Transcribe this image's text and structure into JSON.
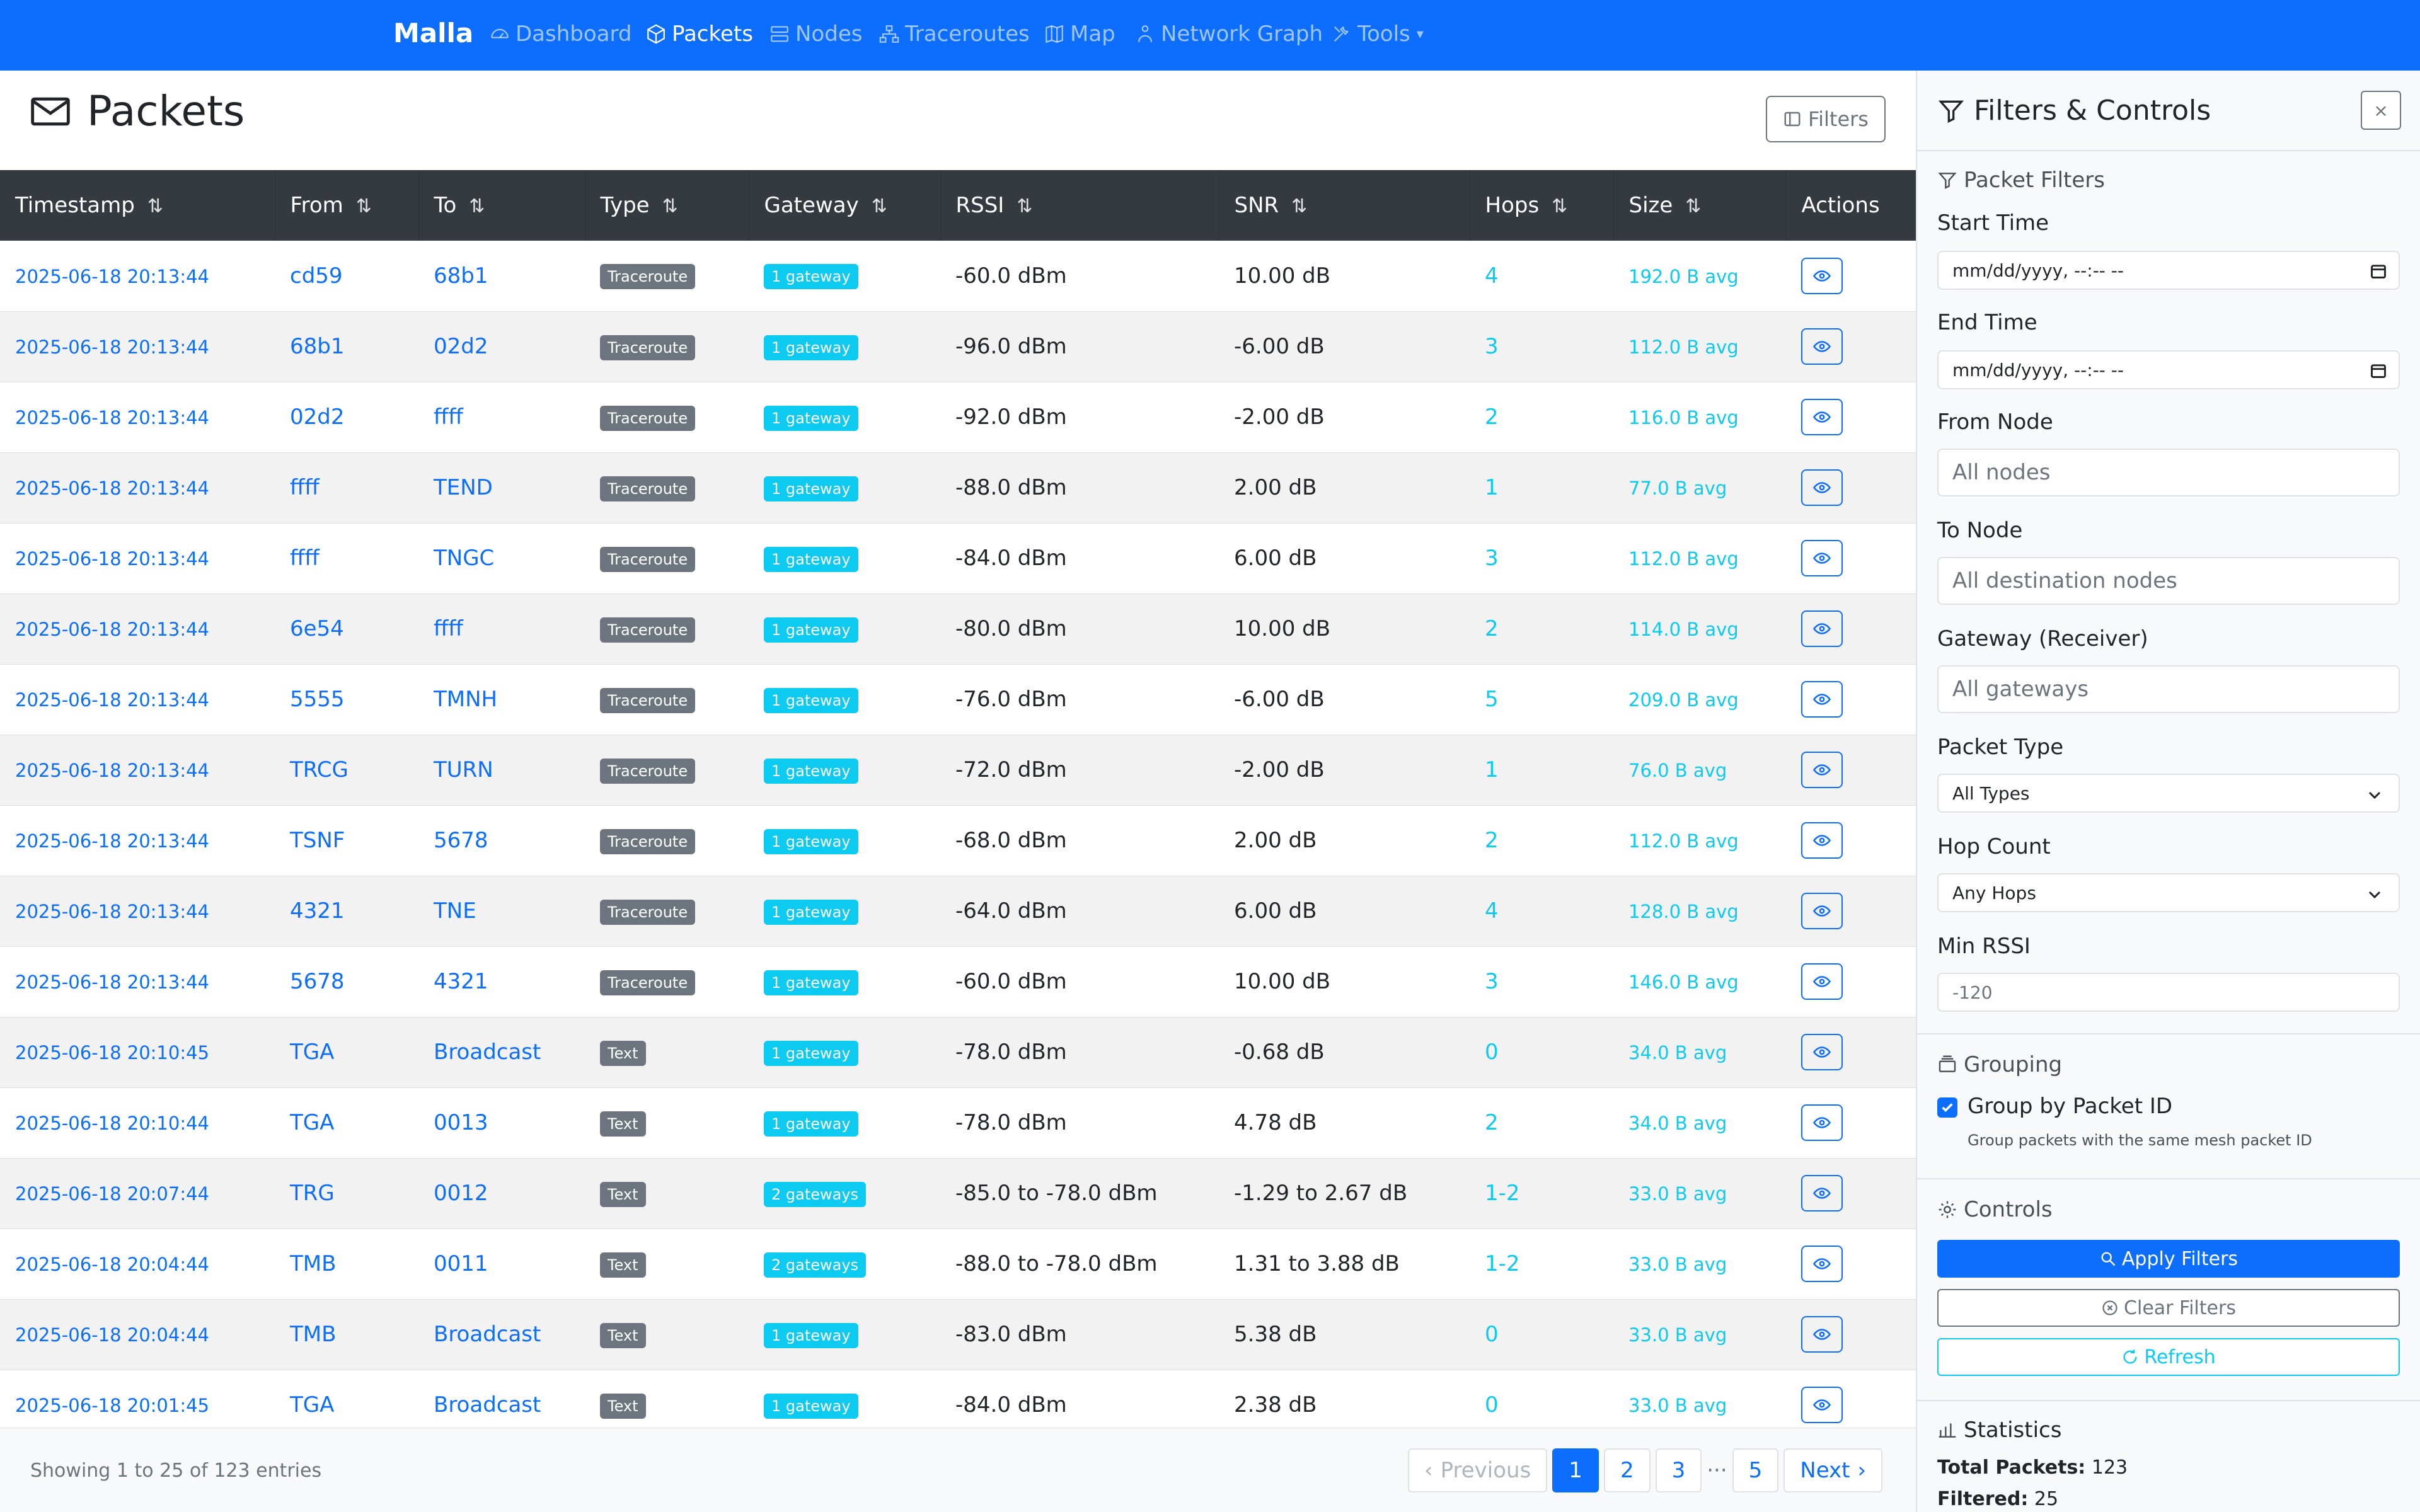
{
  "nav": {
    "brand": "Malla",
    "items": [
      {
        "label": "Dashboard",
        "icon": "dashboard-icon"
      },
      {
        "label": "Packets",
        "icon": "packet-box-icon",
        "active": true
      },
      {
        "label": "Nodes",
        "icon": "nodes-icon"
      },
      {
        "label": "Traceroutes",
        "icon": "traceroute-icon"
      },
      {
        "label": "Map",
        "icon": "map-icon"
      },
      {
        "label": "Network Graph",
        "icon": "network-graph-icon"
      },
      {
        "label": "Tools",
        "icon": "tools-icon"
      }
    ]
  },
  "page": {
    "title": "Packets",
    "filters_button": "Filters"
  },
  "table": {
    "columns": [
      "Timestamp",
      "From",
      "To",
      "Type",
      "Gateway",
      "RSSI",
      "SNR",
      "Hops",
      "Size",
      "Actions"
    ],
    "sort_glyph": "⇅",
    "rows": [
      {
        "timestamp": "2025-06-18 20:13:44",
        "from": "cd59",
        "to": "68b1",
        "type": "Traceroute",
        "gateway": "1 gateway",
        "rssi": "-60.0 dBm",
        "snr": "10.00 dB",
        "hops": "4",
        "size": "192.0 B avg"
      },
      {
        "timestamp": "2025-06-18 20:13:44",
        "from": "68b1",
        "to": "02d2",
        "type": "Traceroute",
        "gateway": "1 gateway",
        "rssi": "-96.0 dBm",
        "snr": "-6.00 dB",
        "hops": "3",
        "size": "112.0 B avg"
      },
      {
        "timestamp": "2025-06-18 20:13:44",
        "from": "02d2",
        "to": "ffff",
        "type": "Traceroute",
        "gateway": "1 gateway",
        "rssi": "-92.0 dBm",
        "snr": "-2.00 dB",
        "hops": "2",
        "size": "116.0 B avg"
      },
      {
        "timestamp": "2025-06-18 20:13:44",
        "from": "ffff",
        "to": "TEND",
        "type": "Traceroute",
        "gateway": "1 gateway",
        "rssi": "-88.0 dBm",
        "snr": "2.00 dB",
        "hops": "1",
        "size": "77.0 B avg"
      },
      {
        "timestamp": "2025-06-18 20:13:44",
        "from": "ffff",
        "to": "TNGC",
        "type": "Traceroute",
        "gateway": "1 gateway",
        "rssi": "-84.0 dBm",
        "snr": "6.00 dB",
        "hops": "3",
        "size": "112.0 B avg"
      },
      {
        "timestamp": "2025-06-18 20:13:44",
        "from": "6e54",
        "to": "ffff",
        "type": "Traceroute",
        "gateway": "1 gateway",
        "rssi": "-80.0 dBm",
        "snr": "10.00 dB",
        "hops": "2",
        "size": "114.0 B avg"
      },
      {
        "timestamp": "2025-06-18 20:13:44",
        "from": "5555",
        "to": "TMNH",
        "type": "Traceroute",
        "gateway": "1 gateway",
        "rssi": "-76.0 dBm",
        "snr": "-6.00 dB",
        "hops": "5",
        "size": "209.0 B avg"
      },
      {
        "timestamp": "2025-06-18 20:13:44",
        "from": "TRCG",
        "to": "TURN",
        "type": "Traceroute",
        "gateway": "1 gateway",
        "rssi": "-72.0 dBm",
        "snr": "-2.00 dB",
        "hops": "1",
        "size": "76.0 B avg"
      },
      {
        "timestamp": "2025-06-18 20:13:44",
        "from": "TSNF",
        "to": "5678",
        "type": "Traceroute",
        "gateway": "1 gateway",
        "rssi": "-68.0 dBm",
        "snr": "2.00 dB",
        "hops": "2",
        "size": "112.0 B avg"
      },
      {
        "timestamp": "2025-06-18 20:13:44",
        "from": "4321",
        "to": "TNE",
        "type": "Traceroute",
        "gateway": "1 gateway",
        "rssi": "-64.0 dBm",
        "snr": "6.00 dB",
        "hops": "4",
        "size": "128.0 B avg"
      },
      {
        "timestamp": "2025-06-18 20:13:44",
        "from": "5678",
        "to": "4321",
        "type": "Traceroute",
        "gateway": "1 gateway",
        "rssi": "-60.0 dBm",
        "snr": "10.00 dB",
        "hops": "3",
        "size": "146.0 B avg"
      },
      {
        "timestamp": "2025-06-18 20:10:45",
        "from": "TGA",
        "to": "Broadcast",
        "type": "Text",
        "gateway": "1 gateway",
        "rssi": "-78.0 dBm",
        "snr": "-0.68 dB",
        "hops": "0",
        "size": "34.0 B avg"
      },
      {
        "timestamp": "2025-06-18 20:10:44",
        "from": "TGA",
        "to": "0013",
        "type": "Text",
        "gateway": "1 gateway",
        "rssi": "-78.0 dBm",
        "snr": "4.78 dB",
        "hops": "2",
        "size": "34.0 B avg"
      },
      {
        "timestamp": "2025-06-18 20:07:44",
        "from": "TRG",
        "to": "0012",
        "type": "Text",
        "gateway": "2 gateways",
        "rssi": "-85.0 to -78.0 dBm",
        "snr": "-1.29 to 2.67 dB",
        "hops": "1-2",
        "size": "33.0 B avg"
      },
      {
        "timestamp": "2025-06-18 20:04:44",
        "from": "TMB",
        "to": "0011",
        "type": "Text",
        "gateway": "2 gateways",
        "rssi": "-88.0 to -78.0 dBm",
        "snr": "1.31 to 3.88 dB",
        "hops": "1-2",
        "size": "33.0 B avg"
      },
      {
        "timestamp": "2025-06-18 20:04:44",
        "from": "TMB",
        "to": "Broadcast",
        "type": "Text",
        "gateway": "1 gateway",
        "rssi": "-83.0 dBm",
        "snr": "5.38 dB",
        "hops": "0",
        "size": "33.0 B avg"
      },
      {
        "timestamp": "2025-06-18 20:01:45",
        "from": "TGA",
        "to": "Broadcast",
        "type": "Text",
        "gateway": "1 gateway",
        "rssi": "-84.0 dBm",
        "snr": "2.38 dB",
        "hops": "0",
        "size": "33.0 B avg"
      }
    ]
  },
  "footer": {
    "entries_text": "Showing 1 to 25 of 123 entries",
    "previous": "Previous",
    "pages": [
      "1",
      "2",
      "3",
      "5"
    ],
    "ellipsis": "···",
    "next": "Next"
  },
  "sidebar": {
    "title": "Filters & Controls",
    "close": "×",
    "packet_filters_heading": "Packet Filters",
    "start_time_label": "Start Time",
    "start_time_placeholder": "mm/dd/yyyy, --:-- --",
    "end_time_label": "End Time",
    "end_time_placeholder": "mm/dd/yyyy, --:-- --",
    "from_node_label": "From Node",
    "from_node_placeholder": "All nodes",
    "to_node_label": "To Node",
    "to_node_placeholder": "All destination nodes",
    "gateway_label": "Gateway (Receiver)",
    "gateway_placeholder": "All gateways",
    "packet_type_label": "Packet Type",
    "packet_type_value": "All Types",
    "hop_count_label": "Hop Count",
    "hop_count_value": "Any Hops",
    "min_rssi_label": "Min RSSI",
    "min_rssi_placeholder": "-120",
    "grouping_heading": "Grouping",
    "group_by_label": "Group by Packet ID",
    "group_by_checked": true,
    "group_by_help": "Group packets with the same mesh packet ID",
    "controls_heading": "Controls",
    "apply_label": "Apply Filters",
    "clear_label": "Clear Filters",
    "refresh_label": "Refresh",
    "statistics_heading": "Statistics",
    "total_packets_label": "Total Packets:",
    "total_packets_value": "123",
    "filtered_label": "Filtered:",
    "filtered_value": "25"
  },
  "colors": {
    "primary": "#0d6efd",
    "info": "#0dcaf0",
    "secondary": "#6c757d",
    "table_header": "#343a40"
  }
}
